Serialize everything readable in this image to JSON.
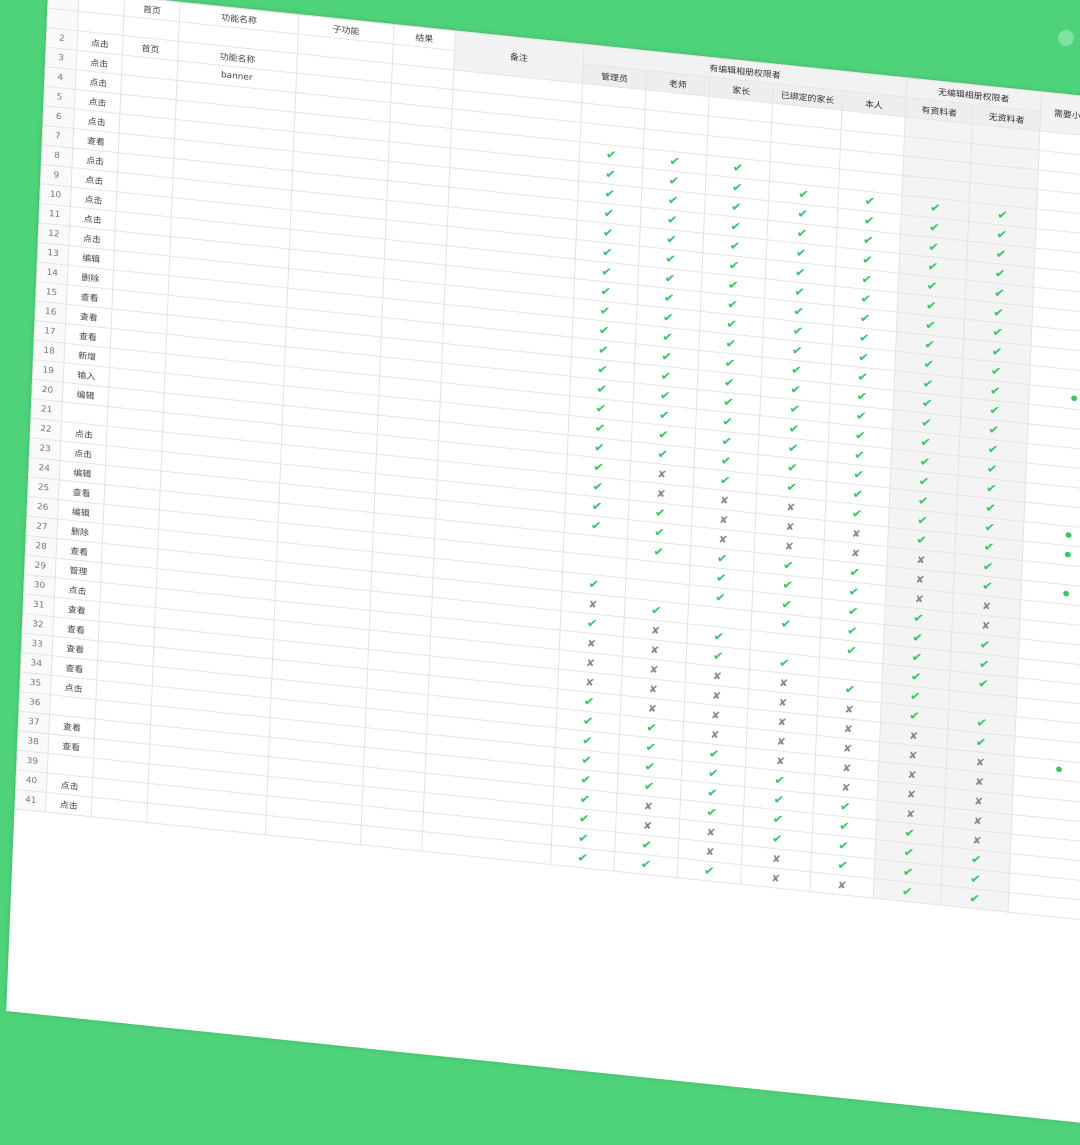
{
  "colors": {
    "background": "#4fd37a",
    "check": "#3cc46a",
    "cross": "#888888"
  },
  "symbols": {
    "check": "✔",
    "cross": "✘"
  },
  "headers": {
    "col_b": "",
    "col_c": "首页",
    "col_d": "功能名称",
    "col_e": "子功能",
    "col_f": "结果",
    "col_g": "备注",
    "group_perm": "有编辑相册权限者",
    "group_noperm": "无编辑相册权限者",
    "group_mini": "需要小程序授权",
    "perm_roles": [
      "管理员",
      "老师",
      "家长",
      "已绑定的家长",
      "本人"
    ],
    "noperm_roles": [
      "有资料者",
      "无资料者"
    ]
  },
  "rows": [
    {
      "num": "2",
      "b": "点击",
      "c": "首页",
      "d": "功能名称",
      "e": "",
      "f": "",
      "g": "",
      "marks": [
        "",
        "",
        "",
        "",
        "",
        "",
        "",
        ""
      ]
    },
    {
      "num": "3",
      "b": "点击",
      "c": "",
      "d": "banner",
      "e": "",
      "f": "",
      "g": "",
      "marks": [
        "",
        "",
        "",
        "",
        "",
        "",
        "",
        ""
      ]
    },
    {
      "num": "4",
      "b": "点击",
      "c": "",
      "d": "",
      "e": "",
      "f": "",
      "g": "",
      "marks": [
        "",
        "",
        "",
        "",
        "",
        "",
        "",
        ""
      ]
    },
    {
      "num": "5",
      "b": "点击",
      "c": "",
      "d": "",
      "e": "",
      "f": "",
      "g": "",
      "marks": [
        "c",
        "c",
        "c",
        "",
        "",
        "",
        "",
        ""
      ]
    },
    {
      "num": "6",
      "b": "点击",
      "c": "",
      "d": "",
      "e": "",
      "f": "",
      "g": "",
      "marks": [
        "c",
        "c",
        "c",
        "c",
        "c",
        "c",
        "c",
        ""
      ]
    },
    {
      "num": "7",
      "b": "查看",
      "c": "",
      "d": "",
      "e": "",
      "f": "",
      "g": "",
      "marks": [
        "c",
        "c",
        "c",
        "c",
        "c",
        "c",
        "c",
        ""
      ]
    },
    {
      "num": "8",
      "b": "点击",
      "c": "",
      "d": "",
      "e": "",
      "f": "",
      "g": "",
      "marks": [
        "c",
        "c",
        "c",
        "c",
        "c",
        "c",
        "c",
        ""
      ]
    },
    {
      "num": "9",
      "b": "点击",
      "c": "",
      "d": "",
      "e": "",
      "f": "",
      "g": "",
      "marks": [
        "c",
        "c",
        "c",
        "c",
        "c",
        "c",
        "c",
        ""
      ]
    },
    {
      "num": "10",
      "b": "点击",
      "c": "",
      "d": "",
      "e": "",
      "f": "",
      "g": "",
      "marks": [
        "c",
        "c",
        "c",
        "c",
        "c",
        "c",
        "c",
        ""
      ]
    },
    {
      "num": "11",
      "b": "点击",
      "c": "",
      "d": "",
      "e": "",
      "f": "",
      "g": "",
      "marks": [
        "c",
        "c",
        "c",
        "c",
        "c",
        "c",
        "c",
        ""
      ]
    },
    {
      "num": "12",
      "b": "点击",
      "c": "",
      "d": "",
      "e": "",
      "f": "",
      "g": "",
      "marks": [
        "c",
        "c",
        "c",
        "c",
        "c",
        "c",
        "c",
        ""
      ]
    },
    {
      "num": "13",
      "b": "编辑",
      "c": "",
      "d": "",
      "e": "",
      "f": "",
      "g": "",
      "marks": [
        "c",
        "c",
        "c",
        "c",
        "c",
        "c",
        "c",
        ""
      ]
    },
    {
      "num": "14",
      "b": "删除",
      "c": "",
      "d": "",
      "e": "",
      "f": "",
      "g": "",
      "marks": [
        "c",
        "c",
        "c",
        "c",
        "c",
        "c",
        "c",
        ""
      ]
    },
    {
      "num": "15",
      "b": "查看",
      "c": "",
      "d": "",
      "e": "",
      "f": "",
      "g": "",
      "marks": [
        "c",
        "c",
        "c",
        "c",
        "c",
        "c",
        "c",
        "d"
      ]
    },
    {
      "num": "16",
      "b": "查看",
      "c": "",
      "d": "",
      "e": "",
      "f": "",
      "g": "",
      "marks": [
        "c",
        "c",
        "c",
        "c",
        "c",
        "c",
        "c",
        ""
      ]
    },
    {
      "num": "17",
      "b": "查看",
      "c": "",
      "d": "",
      "e": "",
      "f": "",
      "g": "",
      "marks": [
        "c",
        "c",
        "c",
        "c",
        "c",
        "c",
        "c",
        ""
      ]
    },
    {
      "num": "18",
      "b": "新增",
      "c": "",
      "d": "",
      "e": "",
      "f": "",
      "g": "",
      "marks": [
        "c",
        "c",
        "c",
        "c",
        "c",
        "c",
        "c",
        ""
      ]
    },
    {
      "num": "19",
      "b": "输入",
      "c": "",
      "d": "",
      "e": "",
      "f": "",
      "g": "",
      "marks": [
        "c",
        "c",
        "c",
        "c",
        "c",
        "c",
        "c",
        ""
      ]
    },
    {
      "num": "20",
      "b": "编辑",
      "c": "",
      "d": "",
      "e": "",
      "f": "",
      "g": "",
      "marks": [
        "c",
        "c",
        "c",
        "c",
        "c",
        "c",
        "c",
        ""
      ]
    },
    {
      "num": "21",
      "b": "",
      "c": "",
      "d": "",
      "e": "",
      "f": "",
      "g": "",
      "marks": [
        "c",
        "x",
        "c",
        "c",
        "c",
        "c",
        "c",
        ""
      ]
    },
    {
      "num": "22",
      "b": "点击",
      "c": "",
      "d": "",
      "e": "",
      "f": "",
      "g": "",
      "marks": [
        "c",
        "x",
        "x",
        "x",
        "c",
        "c",
        "c",
        "d"
      ]
    },
    {
      "num": "23",
      "b": "点击",
      "c": "",
      "d": "",
      "e": "",
      "f": "",
      "g": "",
      "marks": [
        "c",
        "c",
        "x",
        "x",
        "x",
        "c",
        "c",
        "d"
      ]
    },
    {
      "num": "24",
      "b": "编辑",
      "c": "",
      "d": "",
      "e": "",
      "f": "",
      "g": "",
      "marks": [
        "c",
        "c",
        "x",
        "x",
        "x",
        "x",
        "c",
        ""
      ]
    },
    {
      "num": "25",
      "b": "查看",
      "c": "",
      "d": "",
      "e": "",
      "f": "",
      "g": "",
      "marks": [
        "",
        "c",
        "c",
        "c",
        "c",
        "x",
        "c",
        "d"
      ]
    },
    {
      "num": "26",
      "b": "编辑",
      "c": "",
      "d": "",
      "e": "",
      "f": "",
      "g": "",
      "marks": [
        "",
        "",
        "c",
        "c",
        "c",
        "x",
        "x",
        ""
      ]
    },
    {
      "num": "27",
      "b": "删除",
      "c": "",
      "d": "",
      "e": "",
      "f": "",
      "g": "",
      "marks": [
        "c",
        "",
        "c",
        "c",
        "c",
        "c",
        "x",
        ""
      ]
    },
    {
      "num": "28",
      "b": "查看",
      "c": "",
      "d": "",
      "e": "",
      "f": "",
      "g": "",
      "marks": [
        "x",
        "c",
        "",
        "c",
        "c",
        "c",
        "c",
        ""
      ]
    },
    {
      "num": "29",
      "b": "管理",
      "c": "",
      "d": "",
      "e": "",
      "f": "",
      "g": "",
      "marks": [
        "c",
        "x",
        "c",
        "",
        "c",
        "c",
        "c",
        ""
      ]
    },
    {
      "num": "30",
      "b": "点击",
      "c": "",
      "d": "",
      "e": "",
      "f": "",
      "g": "",
      "marks": [
        "x",
        "x",
        "c",
        "c",
        "",
        "c",
        "c",
        ""
      ]
    },
    {
      "num": "31",
      "b": "查看",
      "c": "",
      "d": "",
      "e": "",
      "f": "",
      "g": "",
      "marks": [
        "x",
        "x",
        "x",
        "x",
        "c",
        "c",
        "",
        ""
      ]
    },
    {
      "num": "32",
      "b": "查看",
      "c": "",
      "d": "",
      "e": "",
      "f": "",
      "g": "",
      "marks": [
        "x",
        "x",
        "x",
        "x",
        "x",
        "c",
        "c",
        ""
      ]
    },
    {
      "num": "33",
      "b": "查看",
      "c": "",
      "d": "",
      "e": "",
      "f": "",
      "g": "",
      "marks": [
        "c",
        "x",
        "x",
        "x",
        "x",
        "x",
        "c",
        ""
      ]
    },
    {
      "num": "34",
      "b": "查看",
      "c": "",
      "d": "",
      "e": "",
      "f": "",
      "g": "",
      "marks": [
        "c",
        "c",
        "x",
        "x",
        "x",
        "x",
        "x",
        "d"
      ]
    },
    {
      "num": "35",
      "b": "点击",
      "c": "",
      "d": "",
      "e": "",
      "f": "",
      "g": "",
      "marks": [
        "c",
        "c",
        "c",
        "x",
        "x",
        "x",
        "x",
        ""
      ]
    },
    {
      "num": "36",
      "b": "",
      "c": "",
      "d": "",
      "e": "",
      "f": "",
      "g": "",
      "marks": [
        "c",
        "c",
        "c",
        "c",
        "x",
        "x",
        "x",
        ""
      ]
    },
    {
      "num": "37",
      "b": "查看",
      "c": "",
      "d": "",
      "e": "",
      "f": "",
      "g": "",
      "marks": [
        "c",
        "c",
        "c",
        "c",
        "c",
        "x",
        "x",
        ""
      ]
    },
    {
      "num": "38",
      "b": "查看",
      "c": "",
      "d": "",
      "e": "",
      "f": "",
      "g": "",
      "marks": [
        "c",
        "x",
        "c",
        "c",
        "c",
        "c",
        "x",
        ""
      ]
    },
    {
      "num": "39",
      "b": "",
      "c": "",
      "d": "",
      "e": "",
      "f": "",
      "g": "",
      "marks": [
        "c",
        "x",
        "x",
        "c",
        "c",
        "c",
        "c",
        ""
      ]
    },
    {
      "num": "40",
      "b": "点击",
      "c": "",
      "d": "",
      "e": "",
      "f": "",
      "g": "",
      "marks": [
        "c",
        "c",
        "x",
        "x",
        "c",
        "c",
        "c",
        ""
      ]
    },
    {
      "num": "41",
      "b": "点击",
      "c": "",
      "d": "",
      "e": "",
      "f": "",
      "g": "",
      "marks": [
        "c",
        "c",
        "c",
        "x",
        "x",
        "c",
        "c",
        ""
      ]
    }
  ]
}
